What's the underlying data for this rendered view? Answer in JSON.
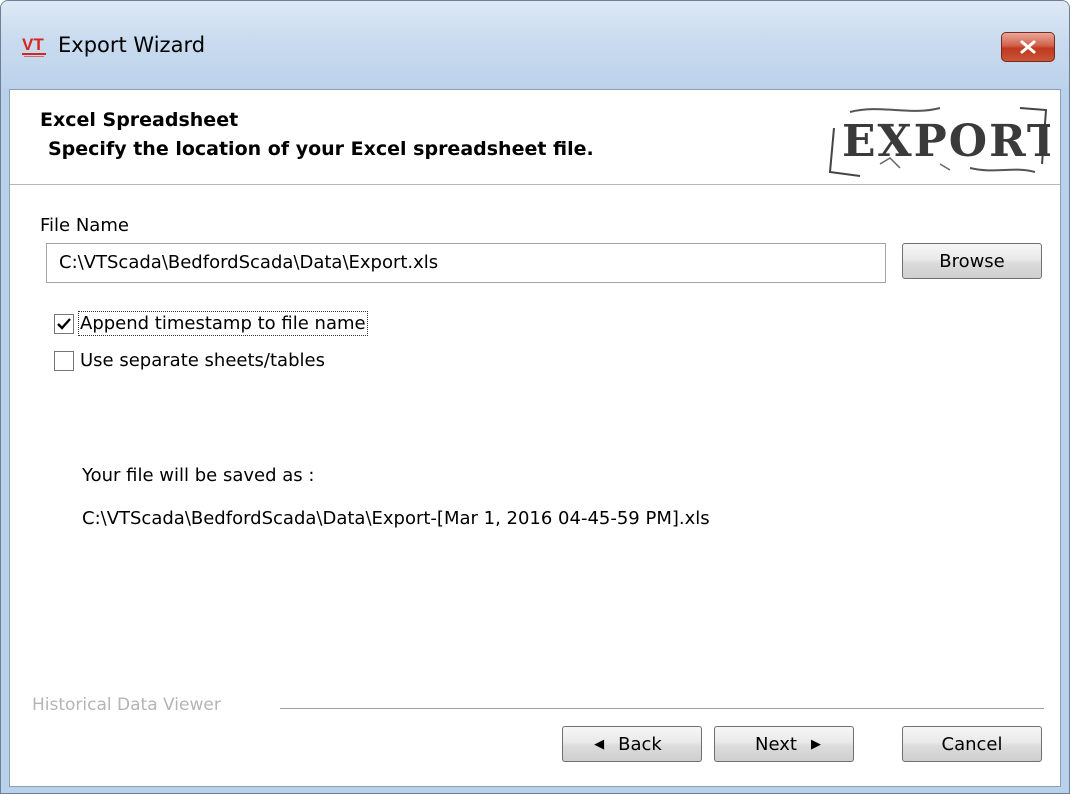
{
  "window": {
    "title": "Export Wizard",
    "logo_text": "VT",
    "close_icon": "close-icon"
  },
  "header": {
    "title": "Excel Spreadsheet",
    "subtitle": "Specify the location of your Excel spreadsheet file.",
    "stamp_text": "EXPORT"
  },
  "form": {
    "file_name_label": "File Name",
    "file_name_value": "C:\\VTScada\\BedfordScada\\Data\\Export.xls",
    "browse_label": "Browse",
    "options": [
      {
        "label": "Append timestamp to file name",
        "checked": true
      },
      {
        "label": "Use separate sheets/tables",
        "checked": false
      }
    ],
    "saved_as_label": "Your file will be saved as :",
    "saved_as_path": "C:\\VTScada\\BedfordScada\\Data\\Export-[Mar 1, 2016 04-45-59 PM].xls"
  },
  "footer": {
    "group_label": "Historical Data Viewer",
    "back_label": "Back",
    "next_label": "Next",
    "cancel_label": "Cancel"
  },
  "colors": {
    "title_bar": "#c9dbef",
    "close_button": "#c9553a",
    "logo_red": "#d8261d"
  }
}
